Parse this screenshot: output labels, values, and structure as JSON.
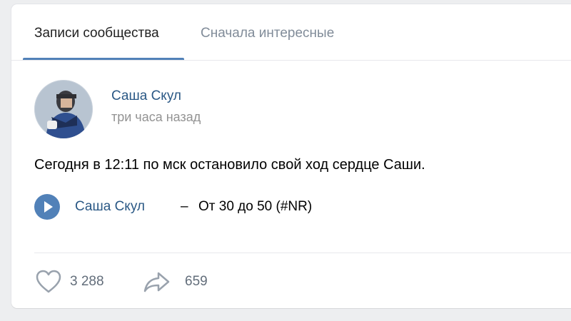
{
  "tabs": {
    "community_posts": "Записи сообщества",
    "interesting_first": "Сначала интересные"
  },
  "post": {
    "author": "Саша Скул",
    "time": "три часа назад",
    "text": "Сегодня в 12:11 по мск остановило свой ход сердце Саши.",
    "audio": {
      "artist": "Саша Скул",
      "separator": "–",
      "title": "От 30 до 50 (#NR)"
    },
    "actions": {
      "likes": "3 288",
      "shares": "659"
    }
  },
  "colors": {
    "accent": "#5181b8",
    "link": "#2a5885",
    "muted": "#939393"
  },
  "icons": {
    "play": "play-icon",
    "like": "heart-icon",
    "share": "share-arrow-icon"
  }
}
